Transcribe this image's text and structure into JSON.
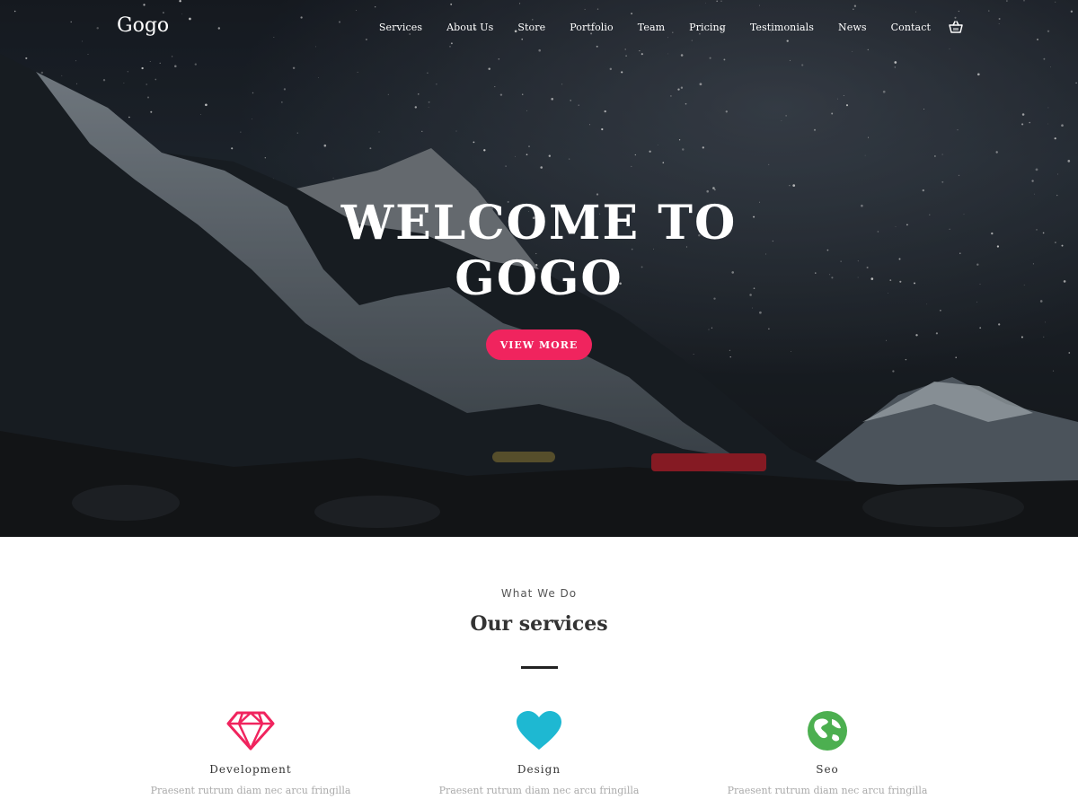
{
  "brand": {
    "logo": "Gogo"
  },
  "nav": {
    "items": [
      "Services",
      "About Us",
      "Store",
      "Portfolio",
      "Team",
      "Pricing",
      "Testimonials",
      "News",
      "Contact"
    ],
    "cart_icon": "shopping-basket-icon"
  },
  "hero": {
    "title_line1": "WELCOME TO",
    "title_line2": "GOGO",
    "button_label": "VIEW MORE"
  },
  "services": {
    "eyebrow": "What We Do",
    "title": "Our services",
    "items": [
      {
        "icon": "diamond-icon",
        "color": "#f0245e",
        "title": "Development",
        "text": "Praesent rutrum diam nec arcu fringilla"
      },
      {
        "icon": "heart-icon",
        "color": "#1eb8d2",
        "title": "Design",
        "text": "Praesent rutrum diam nec arcu fringilla"
      },
      {
        "icon": "globe-icon",
        "color": "#4caf50",
        "title": "Seo",
        "text": "Praesent rutrum diam nec arcu fringilla"
      }
    ]
  },
  "colors": {
    "accent": "#f0245e",
    "heart": "#1eb8d2",
    "globe": "#4caf50"
  }
}
